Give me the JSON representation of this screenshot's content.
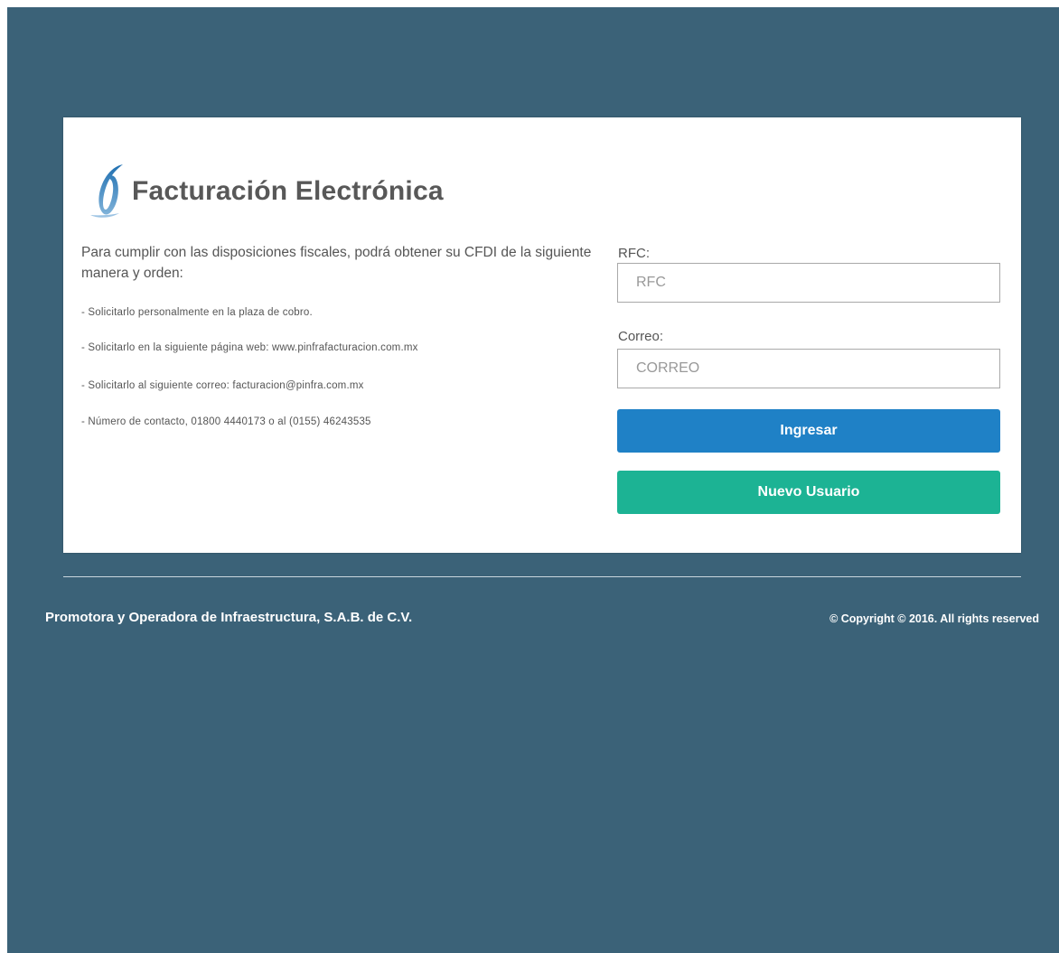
{
  "header": {
    "title": "Facturación Electrónica",
    "logo_icon": "pinfra-logo"
  },
  "info": {
    "intro": "Para cumplir con las disposiciones fiscales, podrá obtener su CFDI de la siguiente manera y orden:",
    "bullets": [
      "- Solicitarlo personalmente en la plaza de cobro.",
      "- Solicitarlo en la siguiente página web: www.pinfrafacturacion.com.mx",
      "- Solicitarlo al siguiente correo: facturacion@pinfra.com.mx",
      "- Número de contacto, 01800 4440173 o al (0155) 46243535"
    ]
  },
  "form": {
    "rfc_label": "RFC:",
    "rfc_placeholder": "RFC",
    "rfc_value": "",
    "email_label": "Correo:",
    "email_placeholder": "CORREO",
    "email_value": "",
    "login_button": "Ingresar",
    "new_user_button": "Nuevo Usuario"
  },
  "footer": {
    "company": "Promotora y Operadora de Infraestructura, S.A.B. de C.V.",
    "copyright": "© Copyright © 2016. All rights reserved"
  },
  "colors": {
    "background": "#3b6278",
    "login_button": "#1f81c6",
    "new_user_button": "#1cb394",
    "logo_blue": "#1f6fb0"
  }
}
